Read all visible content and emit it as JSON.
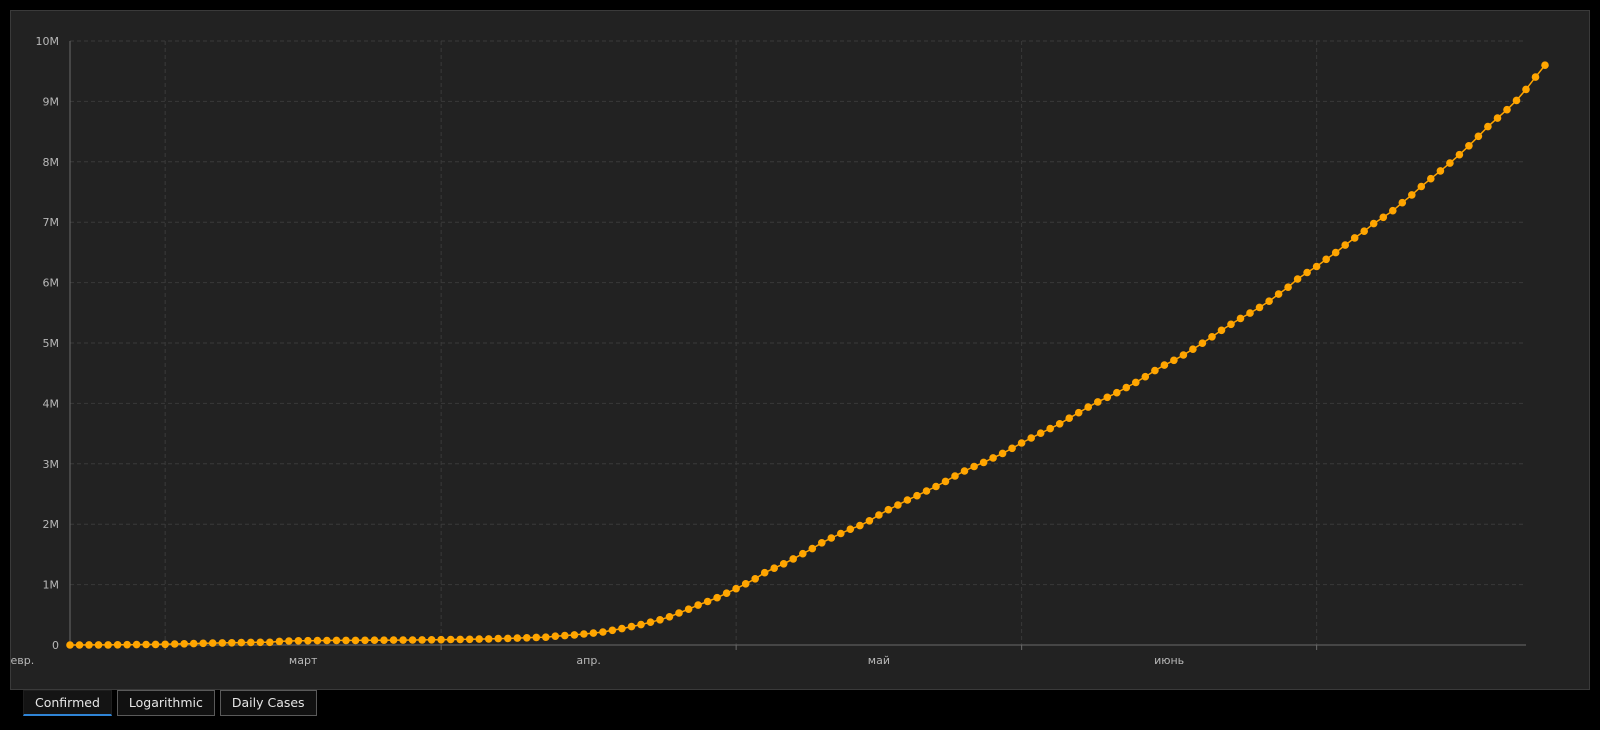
{
  "colors": {
    "background": "#000000",
    "panel": "#222222",
    "grid": "#3a3a3a",
    "axis": "#6a6a6a",
    "tick_text": "#b8b8b8",
    "series": "#ffa500",
    "active_tab_underline": "#2f84d6"
  },
  "tabs": [
    {
      "label": "Confirmed",
      "active": true
    },
    {
      "label": "Logarithmic",
      "active": false
    },
    {
      "label": "Daily Cases",
      "active": false
    }
  ],
  "chart_data": {
    "type": "line",
    "title": "",
    "xlabel": "",
    "ylabel": "",
    "markers": true,
    "grid": true,
    "grid_style": "dashed",
    "x_axis_type": "date",
    "xlim": [
      "2020-01-22",
      "2020-06-23"
    ],
    "ylim": [
      0,
      10000000
    ],
    "y_ticks": [
      0,
      1000000,
      2000000,
      3000000,
      4000000,
      5000000,
      6000000,
      7000000,
      8000000,
      9000000,
      10000000
    ],
    "y_tick_labels": [
      "0",
      "1M",
      "2M",
      "3M",
      "4M",
      "5M",
      "6M",
      "7M",
      "8M",
      "9M",
      "10M"
    ],
    "x_tick_labels": [
      {
        "date": "2020-02-01",
        "label": "февр."
      },
      {
        "date": "2020-03-01",
        "label": "март"
      },
      {
        "date": "2020-04-01",
        "label": "апр."
      },
      {
        "date": "2020-05-01",
        "label": "май"
      },
      {
        "date": "2020-06-01",
        "label": "июнь"
      }
    ],
    "x_gridlines": [
      "2020-02-01",
      "2020-03-01",
      "2020-04-01",
      "2020-05-01",
      "2020-06-01"
    ],
    "series": [
      {
        "start_date": "2020-01-22",
        "interval_days": 1,
        "values": [
          555,
          654,
          941,
          1434,
          2118,
          2927,
          5578,
          6166,
          8234,
          9927,
          12038,
          16787,
          19881,
          23892,
          27635,
          30794,
          34391,
          37120,
          40150,
          42762,
          44802,
          45221,
          60368,
          66885,
          69030,
          71224,
          73258,
          75136,
          75639,
          76197,
          76819,
          78572,
          78958,
          79561,
          80406,
          81388,
          82746,
          84112,
          86011,
          88369,
          90306,
          92840,
          95120,
          97886,
          101801,
          105847,
          109821,
          113590,
          118620,
          125875,
          128352,
          145205,
          156101,
          167454,
          181574,
          197102,
          214821,
          242570,
          272208,
          304507,
          336953,
          378235,
          418045,
          467653,
          529591,
          593291,
          660706,
          720117,
          782365,
          857487,
          932605,
          1013466,
          1095917,
          1197405,
          1272115,
          1345101,
          1426096,
          1511104,
          1595350,
          1691719,
          1771514,
          1846680,
          1917320,
          1976192,
          2056055,
          2152437,
          2240190,
          2317759,
          2401378,
          2472259,
          2549294,
          2624068,
          2708885,
          2797691,
          2881140,
          2955033,
          3023722,
          3097229,
          3172287,
          3256846,
          3343777,
          3427584,
          3506729,
          3583055,
          3662691,
          3755341,
          3845718,
          3938064,
          4024009,
          4101699,
          4177502,
          4261747,
          4347018,
          4442163,
          4542347,
          4634068,
          4713620,
          4801943,
          4897492,
          4996472,
          5102424,
          5210817,
          5310362,
          5407613,
          5495061,
          5589626,
          5691790,
          5808946,
          5924275,
          6059017,
          6166946,
          6265852,
          6386366,
          6496837,
          6620891,
          6740844,
          6850983,
          6976611,
          7081645,
          7190076,
          7322536,
          7451862,
          7591346,
          7719808,
          7849003,
          7978524,
          8118313,
          8265164,
          8422451,
          8581993,
          8724005,
          8863350,
          9017106,
          9198893,
          9402054,
          9600001
        ]
      }
    ]
  }
}
